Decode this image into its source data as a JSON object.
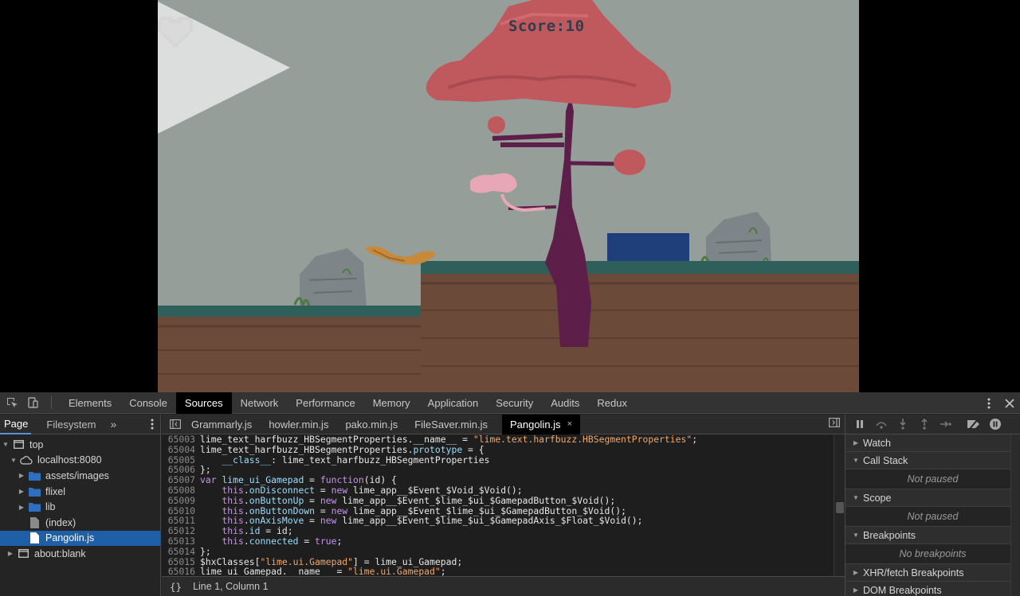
{
  "game": {
    "score_text": "Score:10",
    "hearts": [
      "full",
      "full",
      "empty"
    ],
    "colors": {
      "sky": "#969e9a",
      "ground": "#6b4a3a",
      "grass": "#2e5f5a",
      "tree_top": "#c0595e",
      "trunk": "#5e1e4a",
      "block": "#1e3f7a"
    }
  },
  "devtools": {
    "main_tabs": [
      {
        "label": "Elements"
      },
      {
        "label": "Console"
      },
      {
        "label": "Sources",
        "active": true
      },
      {
        "label": "Network"
      },
      {
        "label": "Performance"
      },
      {
        "label": "Memory"
      },
      {
        "label": "Application"
      },
      {
        "label": "Security"
      },
      {
        "label": "Audits"
      },
      {
        "label": "Redux"
      }
    ],
    "navigator": {
      "tabs": [
        "Page",
        "Filesystem"
      ],
      "more": "»",
      "tree": [
        {
          "label": "top",
          "depth": 0,
          "type": "frame",
          "expanded": true
        },
        {
          "label": "localhost:8080",
          "depth": 1,
          "type": "cloud",
          "expanded": true
        },
        {
          "label": "assets/images",
          "depth": 2,
          "type": "folder",
          "expanded": false
        },
        {
          "label": "flixel",
          "depth": 2,
          "type": "folder",
          "expanded": false
        },
        {
          "label": "lib",
          "depth": 2,
          "type": "folder",
          "expanded": false
        },
        {
          "label": "(index)",
          "depth": 2,
          "type": "file-gray"
        },
        {
          "label": "Pangolin.js",
          "depth": 2,
          "type": "file",
          "selected": true
        },
        {
          "label": "about:blank",
          "depth": 0,
          "type": "frame",
          "expanded": false
        }
      ]
    },
    "file_tabs": [
      {
        "label": "Grammarly.js"
      },
      {
        "label": "howler.min.js"
      },
      {
        "label": "pako.min.js"
      },
      {
        "label": "FileSaver.min.js"
      },
      {
        "label": "Pangolin.js",
        "active": true,
        "close": "×"
      }
    ],
    "code_lines": [
      {
        "n": "65003",
        "html": "lime_text_harfbuzz_HBSegmentProperties.__name__ = <span class=\"s\">\"lime.text.harfbuzz.HBSegmentProperties\"</span>;"
      },
      {
        "n": "65004",
        "html": "lime_text_harfbuzz_HBSegmentProperties.<span class=\"v\">prototype</span> = {"
      },
      {
        "n": "65005",
        "html": "    <span class=\"v\">__class__</span>: lime_text_harfbuzz_HBSegmentProperties"
      },
      {
        "n": "65006",
        "html": "};"
      },
      {
        "n": "65007",
        "html": "<span class=\"k\">var</span> <span class=\"v\">lime_ui_Gamepad</span> = <span class=\"k\">function</span>(id) {"
      },
      {
        "n": "65008",
        "html": "    <span class=\"k\">this</span>.<span class=\"v\">onDisconnect</span> = <span class=\"k\">new</span> lime_app__$Event_$Void_$Void();"
      },
      {
        "n": "65009",
        "html": "    <span class=\"k\">this</span>.<span class=\"v\">onButtonUp</span> = <span class=\"k\">new</span> lime_app__$Event_$lime_$ui_$GamepadButton_$Void();"
      },
      {
        "n": "65010",
        "html": "    <span class=\"k\">this</span>.<span class=\"v\">onButtonDown</span> = <span class=\"k\">new</span> lime_app__$Event_$lime_$ui_$GamepadButton_$Void();"
      },
      {
        "n": "65011",
        "html": "    <span class=\"k\">this</span>.<span class=\"v\">onAxisMove</span> = <span class=\"k\">new</span> lime_app__$Event_$lime_$ui_$GamepadAxis_$Float_$Void();"
      },
      {
        "n": "65012",
        "html": "    <span class=\"k\">this</span>.<span class=\"v\">id</span> = id;"
      },
      {
        "n": "65013",
        "html": "    <span class=\"k\">this</span>.<span class=\"v\">connected</span> = <span class=\"k\">true</span>;"
      },
      {
        "n": "65014",
        "html": "};"
      },
      {
        "n": "65015",
        "html": "$hxClasses[<span class=\"s\">\"lime.ui.Gamepad\"</span>] = lime_ui_Gamepad;"
      },
      {
        "n": "65016",
        "html": "lime_ui_Gamepad.__name__ = <span class=\"s\">\"lime.ui.Gamepad\"</span>;"
      }
    ],
    "status": {
      "braces": "{}",
      "position": "Line 1, Column 1"
    },
    "debugger": {
      "panes": [
        {
          "title": "Watch",
          "expanded": false
        },
        {
          "title": "Call Stack",
          "expanded": true,
          "body": "Not paused"
        },
        {
          "title": "Scope",
          "expanded": true,
          "body": "Not paused"
        },
        {
          "title": "Breakpoints",
          "expanded": true,
          "body": "No breakpoints"
        },
        {
          "title": "XHR/fetch Breakpoints",
          "expanded": false
        },
        {
          "title": "DOM Breakpoints",
          "expanded": false
        }
      ]
    }
  }
}
